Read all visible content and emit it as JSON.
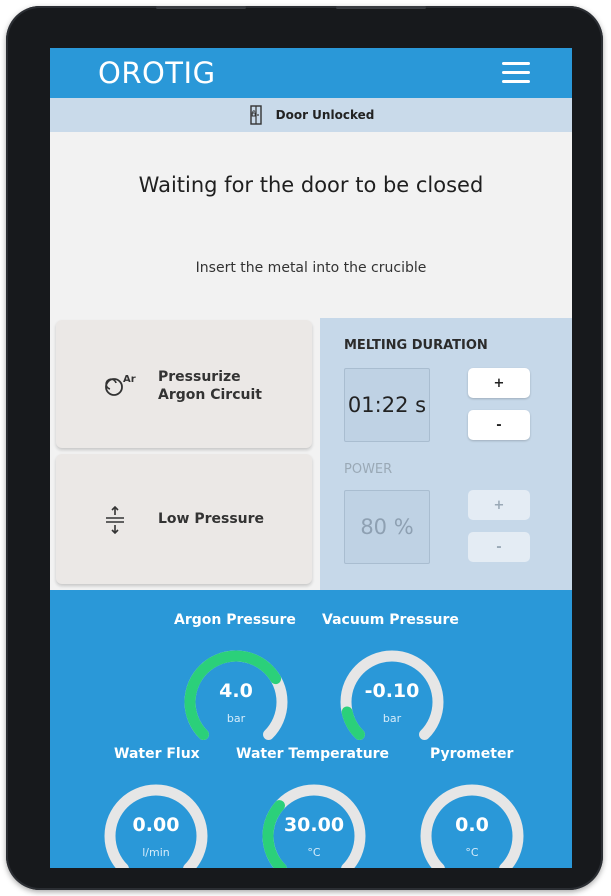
{
  "app": {
    "title": "OROTIG",
    "menu_icon": "hamburger-menu-icon"
  },
  "status": {
    "text": "Door Unlocked",
    "icon": "door-unlocked-icon"
  },
  "message": {
    "title": "Waiting for the door to be closed",
    "subtitle": "Insert the metal into the crucible"
  },
  "actions": [
    {
      "label_line1": "Pressurize",
      "label_line2": "Argon Circuit",
      "icon": "argon-pressurize-icon"
    },
    {
      "label_line1": "Low Pressure",
      "icon": "pressure-arrows-icon"
    }
  ],
  "settings": {
    "melting_duration": {
      "label": "MELTING DURATION",
      "value": "01:22 s",
      "plus": "+",
      "minus": "-"
    },
    "power": {
      "label": "POWER",
      "value": "80 %",
      "plus": "+",
      "minus": "-"
    }
  },
  "gauges": [
    {
      "title": "Argon Pressure",
      "value": "4.0",
      "unit": "bar",
      "fill": 0.72,
      "color": "#2bd07a"
    },
    {
      "title": "Vacuum Pressure",
      "value": "-0.10",
      "unit": "bar",
      "fill": 0.12,
      "color": "#2bd07a"
    },
    {
      "title": "Water Flux",
      "value": "0.00",
      "unit": "l/min",
      "fill": 0.0,
      "color": "#2bd07a"
    },
    {
      "title": "Water Temperature",
      "value": "30.00",
      "unit": "°C",
      "fill": 0.32,
      "color": "#2bd07a"
    },
    {
      "title": "Pyrometer",
      "value": "0.0",
      "unit": "°C",
      "fill": 0.0,
      "color": "#2bd07a"
    }
  ],
  "colors": {
    "primary": "#2a98d8",
    "status_bar": "#c9daea",
    "panel": "#c6d8e9",
    "gauge_track": "#e6e6e6",
    "gauge_fill": "#2bd07a"
  }
}
